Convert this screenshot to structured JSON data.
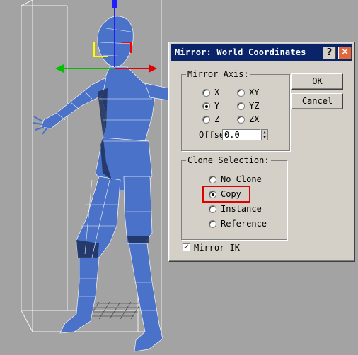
{
  "dialog": {
    "title": "Mirror: World Coordinates",
    "help_glyph": "?",
    "close_glyph": "✕",
    "ok_label": "OK",
    "cancel_label": "Cancel"
  },
  "mirror_axis": {
    "legend": "Mirror Axis:",
    "options": [
      "X",
      "XY",
      "Y",
      "YZ",
      "Z",
      "ZX"
    ],
    "selected": "Y",
    "offset_label": "Offset:",
    "offset_value": "0.0"
  },
  "clone_selection": {
    "legend": "Clone Selection:",
    "options": [
      "No Clone",
      "Copy",
      "Instance",
      "Reference"
    ],
    "selected": "Copy"
  },
  "mirror_ik": {
    "label": "Mirror IK",
    "checked": true
  },
  "colors": {
    "viewport_bg": "#a3a3a3",
    "model_blue": "#4a72c8",
    "titlebar": "#0a246a",
    "highlight": "#e00000"
  }
}
